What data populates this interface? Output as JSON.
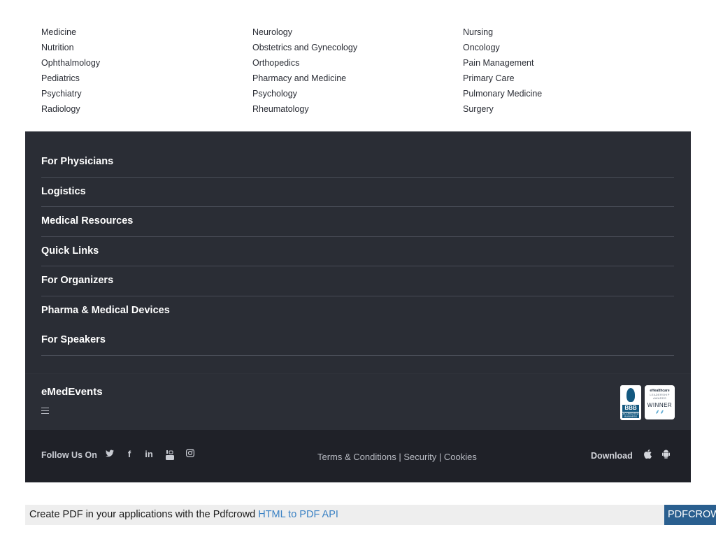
{
  "specialties": {
    "columns": [
      [
        "Medicine",
        "Nutrition",
        "Ophthalmology",
        "Pediatrics",
        "Psychiatry",
        "Radiology"
      ],
      [
        "Neurology",
        "Obstetrics and Gynecology",
        "Orthopedics",
        "Pharmacy and Medicine",
        "Psychology",
        "Rheumatology"
      ],
      [
        "Nursing",
        "Oncology",
        "Pain Management",
        "Primary Care",
        "Pulmonary Medicine",
        "Surgery"
      ]
    ]
  },
  "footer": {
    "sections": [
      "For Physicians",
      "Logistics",
      "Medical Resources",
      "Quick Links",
      "For Organizers",
      "Pharma & Medical Devices",
      "For Speakers"
    ],
    "brand": "eMedEvents",
    "menu_icon": "hamburger-icon",
    "badges": {
      "bbb": {
        "text": "BBB",
        "subtext": "ACCREDITED BUSINESS"
      },
      "award": {
        "line1": "eHealthcare",
        "line2": "LEADERSHIP AWARDS",
        "line3": "WINNER"
      }
    },
    "follow_label": "Follow Us On",
    "social_icons": [
      "twitter-icon",
      "facebook-icon",
      "linkedin-icon",
      "youtube-icon",
      "instagram-icon"
    ],
    "legal": {
      "terms": "Terms & Conditions",
      "sep1": " | ",
      "security": "Security",
      "sep2": " | ",
      "cookies": "Cookies"
    },
    "download_label": "Download",
    "store_icons": [
      "apple-icon",
      "android-icon"
    ]
  },
  "pdf_bar": {
    "text": "Create PDF in your applications with the Pdfcrowd ",
    "link": "HTML to PDF API",
    "badge": "PDFCROWD"
  },
  "colors": {
    "footer_bg": "#2a2d35",
    "bottom_bar_bg": "#1f2128",
    "link_blue": "#3b82c4",
    "badge_blue": "#2a5f8f"
  }
}
